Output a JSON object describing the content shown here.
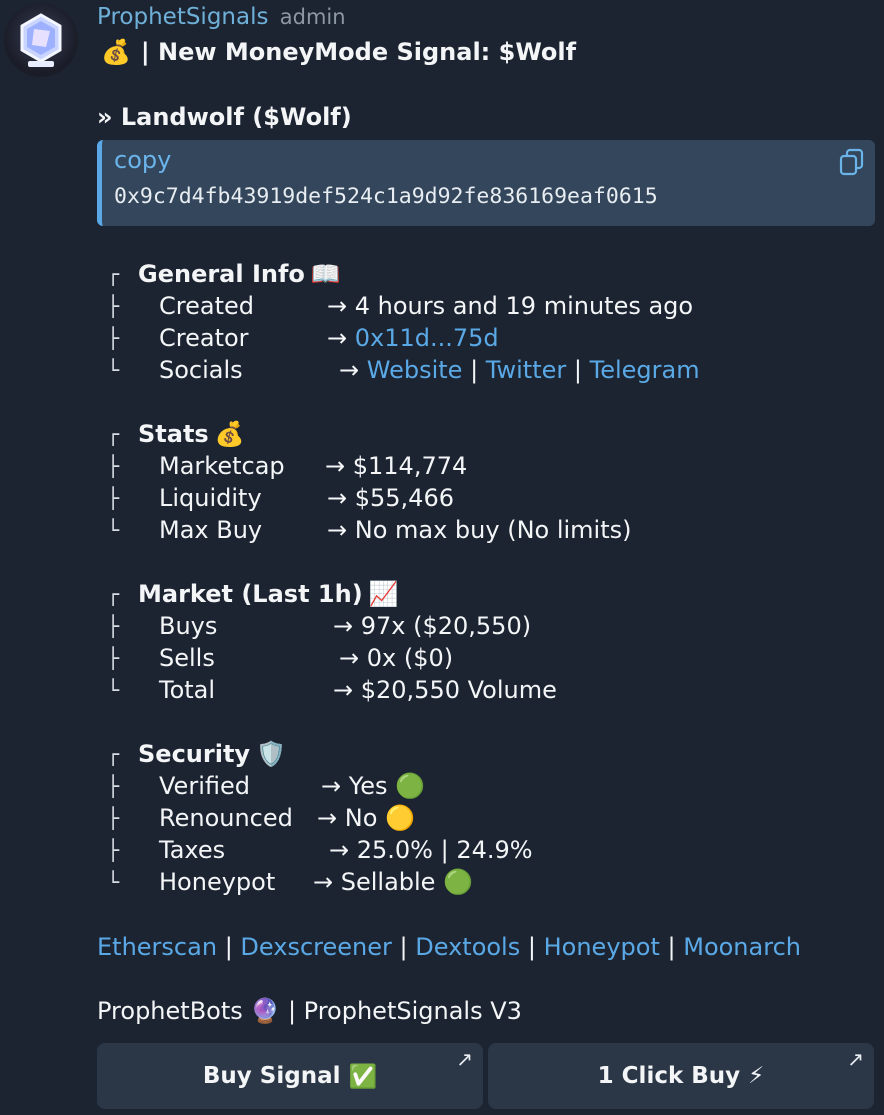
{
  "sender": {
    "name": "ProphetSignals",
    "role": "admin"
  },
  "title": {
    "emoji": "💰",
    "text": "| New MoneyMode Signal: $Wolf"
  },
  "token_line": "» Landwolf ($Wolf)",
  "contract": {
    "label": "copy",
    "address": "0x9c7d4fb43919def524c1a9d92fe836169eaf0615",
    "icon": "copy-icon"
  },
  "sections": {
    "general": {
      "title": "General Info",
      "emoji": "📖",
      "created": {
        "key": "Created",
        "value": "→ 4 hours and 19 minutes ago"
      },
      "creator": {
        "key": "Creator",
        "arrow": "→",
        "link": "0x11d...75d"
      },
      "socials": {
        "key": "Socials",
        "arrow": "→",
        "website": "Website",
        "twitter": "Twitter",
        "telegram": "Telegram",
        "sep": "|"
      }
    },
    "stats": {
      "title": "Stats",
      "emoji": "💰",
      "marketcap": {
        "key": "Marketcap",
        "value": "→ $114,774"
      },
      "liquidity": {
        "key": "Liquidity",
        "value": "→ $55,466"
      },
      "maxbuy": {
        "key": "Max Buy",
        "value": "→ No max buy (No limits)"
      }
    },
    "market": {
      "title": "Market (Last 1h)",
      "emoji": "📈",
      "buys": {
        "key": "Buys",
        "value": "→ 97x ($20,550)"
      },
      "sells": {
        "key": "Sells",
        "value": "→ 0x ($0)"
      },
      "total": {
        "key": "Total",
        "value": "→ $20,550 Volume"
      }
    },
    "security": {
      "title": "Security",
      "emoji": "🛡️",
      "verified": {
        "key": "Verified",
        "value": "→ Yes",
        "emoji": "🟢"
      },
      "renounced": {
        "key": "Renounced",
        "value": "→ No",
        "emoji": "🟡"
      },
      "taxes": {
        "key": "Taxes",
        "value": "→ 25.0% | 24.9%"
      },
      "honeypot": {
        "key": "Honeypot",
        "value": "→ Sellable",
        "emoji": "🟢"
      }
    }
  },
  "tree": {
    "top": "┌",
    "mid": "├",
    "end": "└"
  },
  "links": [
    "Etherscan",
    "Dexscreener",
    "Dextools",
    "Honeypot",
    "Moonarch"
  ],
  "link_sep": "|",
  "footer": {
    "brand": "ProphetBots",
    "emoji": "🔮",
    "text": "| ProphetSignals V3"
  },
  "buttons": [
    {
      "label": "Buy Signal",
      "emoji": "✅",
      "arrow": "↗"
    },
    {
      "label": "1 Click Buy",
      "emoji": "⚡",
      "arrow": "↗"
    }
  ],
  "colors": {
    "background": "#1c2431",
    "link": "#5aa9e6",
    "sender": "#6fb0d8",
    "codebox": "#33465b",
    "button": "#2b3746"
  }
}
